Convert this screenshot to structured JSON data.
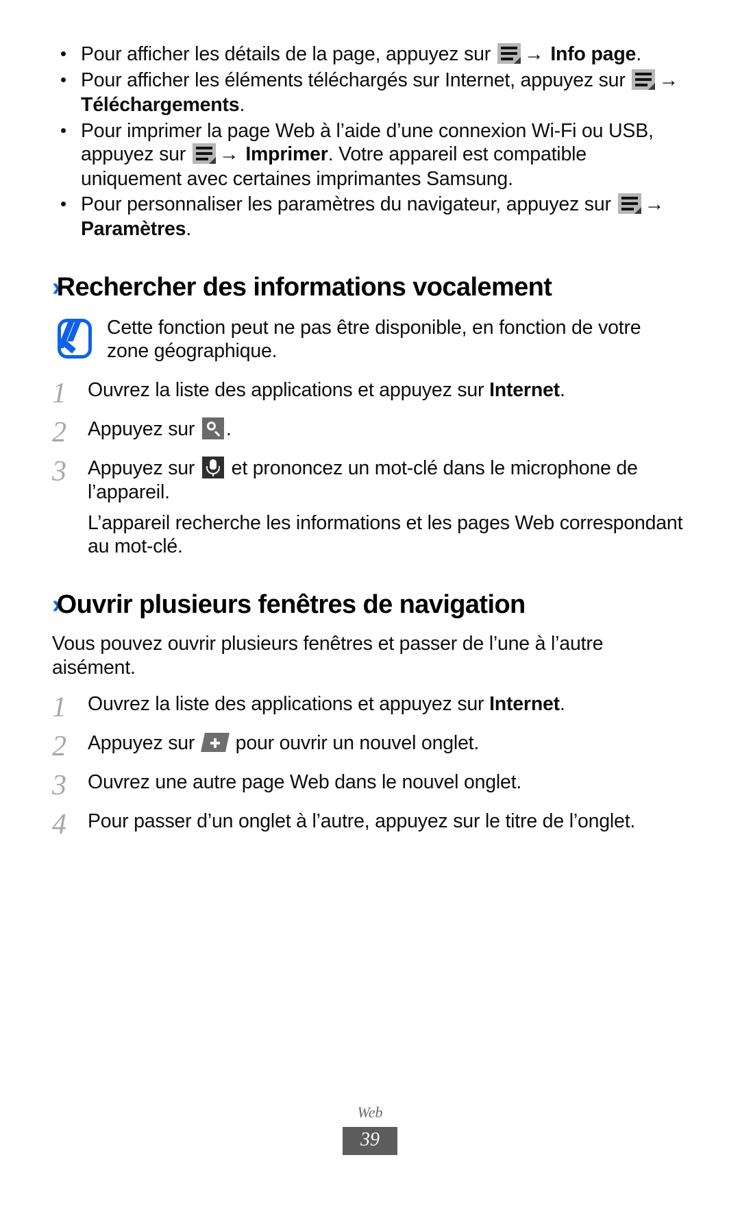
{
  "document": {
    "language": "fr",
    "accent_color": "#0d62e8",
    "bullets": [
      {
        "id": "info-page",
        "seg1": "Pour afficher les détails de la page, appuyez sur ",
        "icon": "menu-key-icon",
        "arrow": "→",
        "bold": "Info page",
        "seg2": "."
      },
      {
        "id": "telechargements",
        "seg1": "Pour afficher les éléments téléchargés sur Internet, appuyez sur ",
        "icon": "menu-key-icon",
        "arrow": "→",
        "bold": "Téléchargements",
        "seg2": "."
      },
      {
        "id": "imprimer",
        "seg1": "Pour imprimer la page Web à l’aide d’une connexion Wi-Fi ou USB, appuyez sur ",
        "icon": "menu-key-icon",
        "arrow": "→",
        "bold": "Imprimer",
        "seg2": ". Votre appareil est compatible uniquement avec certaines imprimantes Samsung."
      },
      {
        "id": "parametres",
        "seg1": "Pour personnaliser les paramètres du navigateur, appuyez sur ",
        "icon": "menu-key-icon",
        "arrow": "→",
        "bold": "Paramètres",
        "seg2": "."
      }
    ],
    "section_voice": {
      "chevron": "›",
      "title": "Rechercher des informations vocalement",
      "note": {
        "icon": "samsung-note-icon",
        "text": "Cette fonction peut ne pas être disponible, en fonction de votre zone géographique."
      },
      "steps": [
        {
          "num": "1",
          "seg1": "Ouvrez la liste des applications et appuyez sur ",
          "bold": "Internet",
          "seg2": "."
        },
        {
          "num": "2",
          "seg1": "Appuyez sur ",
          "icon": "search-icon",
          "seg2": "."
        },
        {
          "num": "3",
          "seg1": "Appuyez sur ",
          "icon": "microphone-icon",
          "seg2": " et prononcez un mot-clé dans le microphone de l’appareil.",
          "extra": "L’appareil recherche les informations et les pages Web correspondant au mot-clé."
        }
      ]
    },
    "section_windows": {
      "chevron": "›",
      "title": "Ouvrir plusieurs fenêtres de navigation",
      "intro": "Vous pouvez ouvrir plusieurs fenêtres et passer de l’une à l’autre aisément.",
      "steps": [
        {
          "num": "1",
          "seg1": "Ouvrez la liste des applications et appuyez sur ",
          "bold": "Internet",
          "seg2": "."
        },
        {
          "num": "2",
          "seg1": "Appuyez sur ",
          "icon": "new-tab-icon",
          "seg2": " pour ouvrir un nouvel onglet."
        },
        {
          "num": "3",
          "seg1": "Ouvrez une autre page Web dans le nouvel onglet."
        },
        {
          "num": "4",
          "seg1": "Pour passer d’un onglet à l’autre, appuyez sur le titre de l’onglet."
        }
      ]
    },
    "footer": {
      "label": "Web",
      "page_number": "39"
    }
  }
}
